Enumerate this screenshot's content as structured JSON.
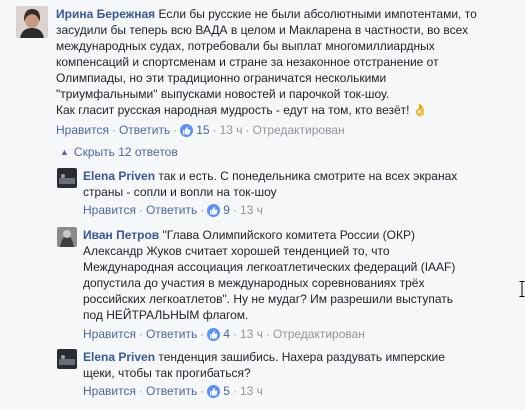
{
  "comment_main": {
    "author": "Ирина Бережная",
    "lines": [
      "Если бы русские не были абсолютными импотентами, то",
      "засудили бы теперь всю ВАДА в целом и Макларена в частности, во всех",
      "международных судах, потребовали бы выплат многомиллиардных",
      "компенсаций и спортсменам и стране за незаконное отстранение от",
      "Олимпиады, но эти традиционно ограничатся несколькими",
      "\"триумфальными\" выпусками новостей и парочкой ток-шоу.",
      "Как гласит русская народная мудрость - едут на том, кто везёт! 👌"
    ],
    "like_label": "Нравится",
    "reply_label": "Ответить",
    "likes": "15",
    "time": "13 ч",
    "edited_label": "Отредактирован"
  },
  "replies_toggle": {
    "label": "Скрыть 12 ответов"
  },
  "reply_1": {
    "author": "Elena Priven",
    "lines": [
      "так и есть. С понедельника смотрите на всех экранах",
      "страны - сопли и вопли на ток-шоу"
    ],
    "like_label": "Нравится",
    "reply_label": "Ответить",
    "likes": "9",
    "time": "13 ч"
  },
  "reply_2": {
    "author": "Иван Петров",
    "lines": [
      "\"Глава Олимпийского комитета России (ОКР)",
      "Александр Жуков считает хорошей тенденцией то, что",
      "Международная ассоциация легкоатлетических федераций (IAAF)",
      "допустила до участия в международных соревнованиях трёх",
      "российских легкоатлетов\". Ну не мудаг? Им разрешили выступать",
      "под НЕЙТРАЛЬНЫМ флагом."
    ],
    "like_label": "Нравится",
    "reply_label": "Ответить",
    "likes": "4",
    "time": "13 ч",
    "edited_label": "Отредактирован"
  },
  "reply_3": {
    "author": "Elena Priven",
    "lines": [
      "тенденция зашибись. Нахера раздувать имперские",
      "щеки, чтобы так прогибаться?"
    ],
    "like_label": "Нравится",
    "reply_label": "Ответить",
    "likes": "5",
    "time": "13 ч"
  }
}
